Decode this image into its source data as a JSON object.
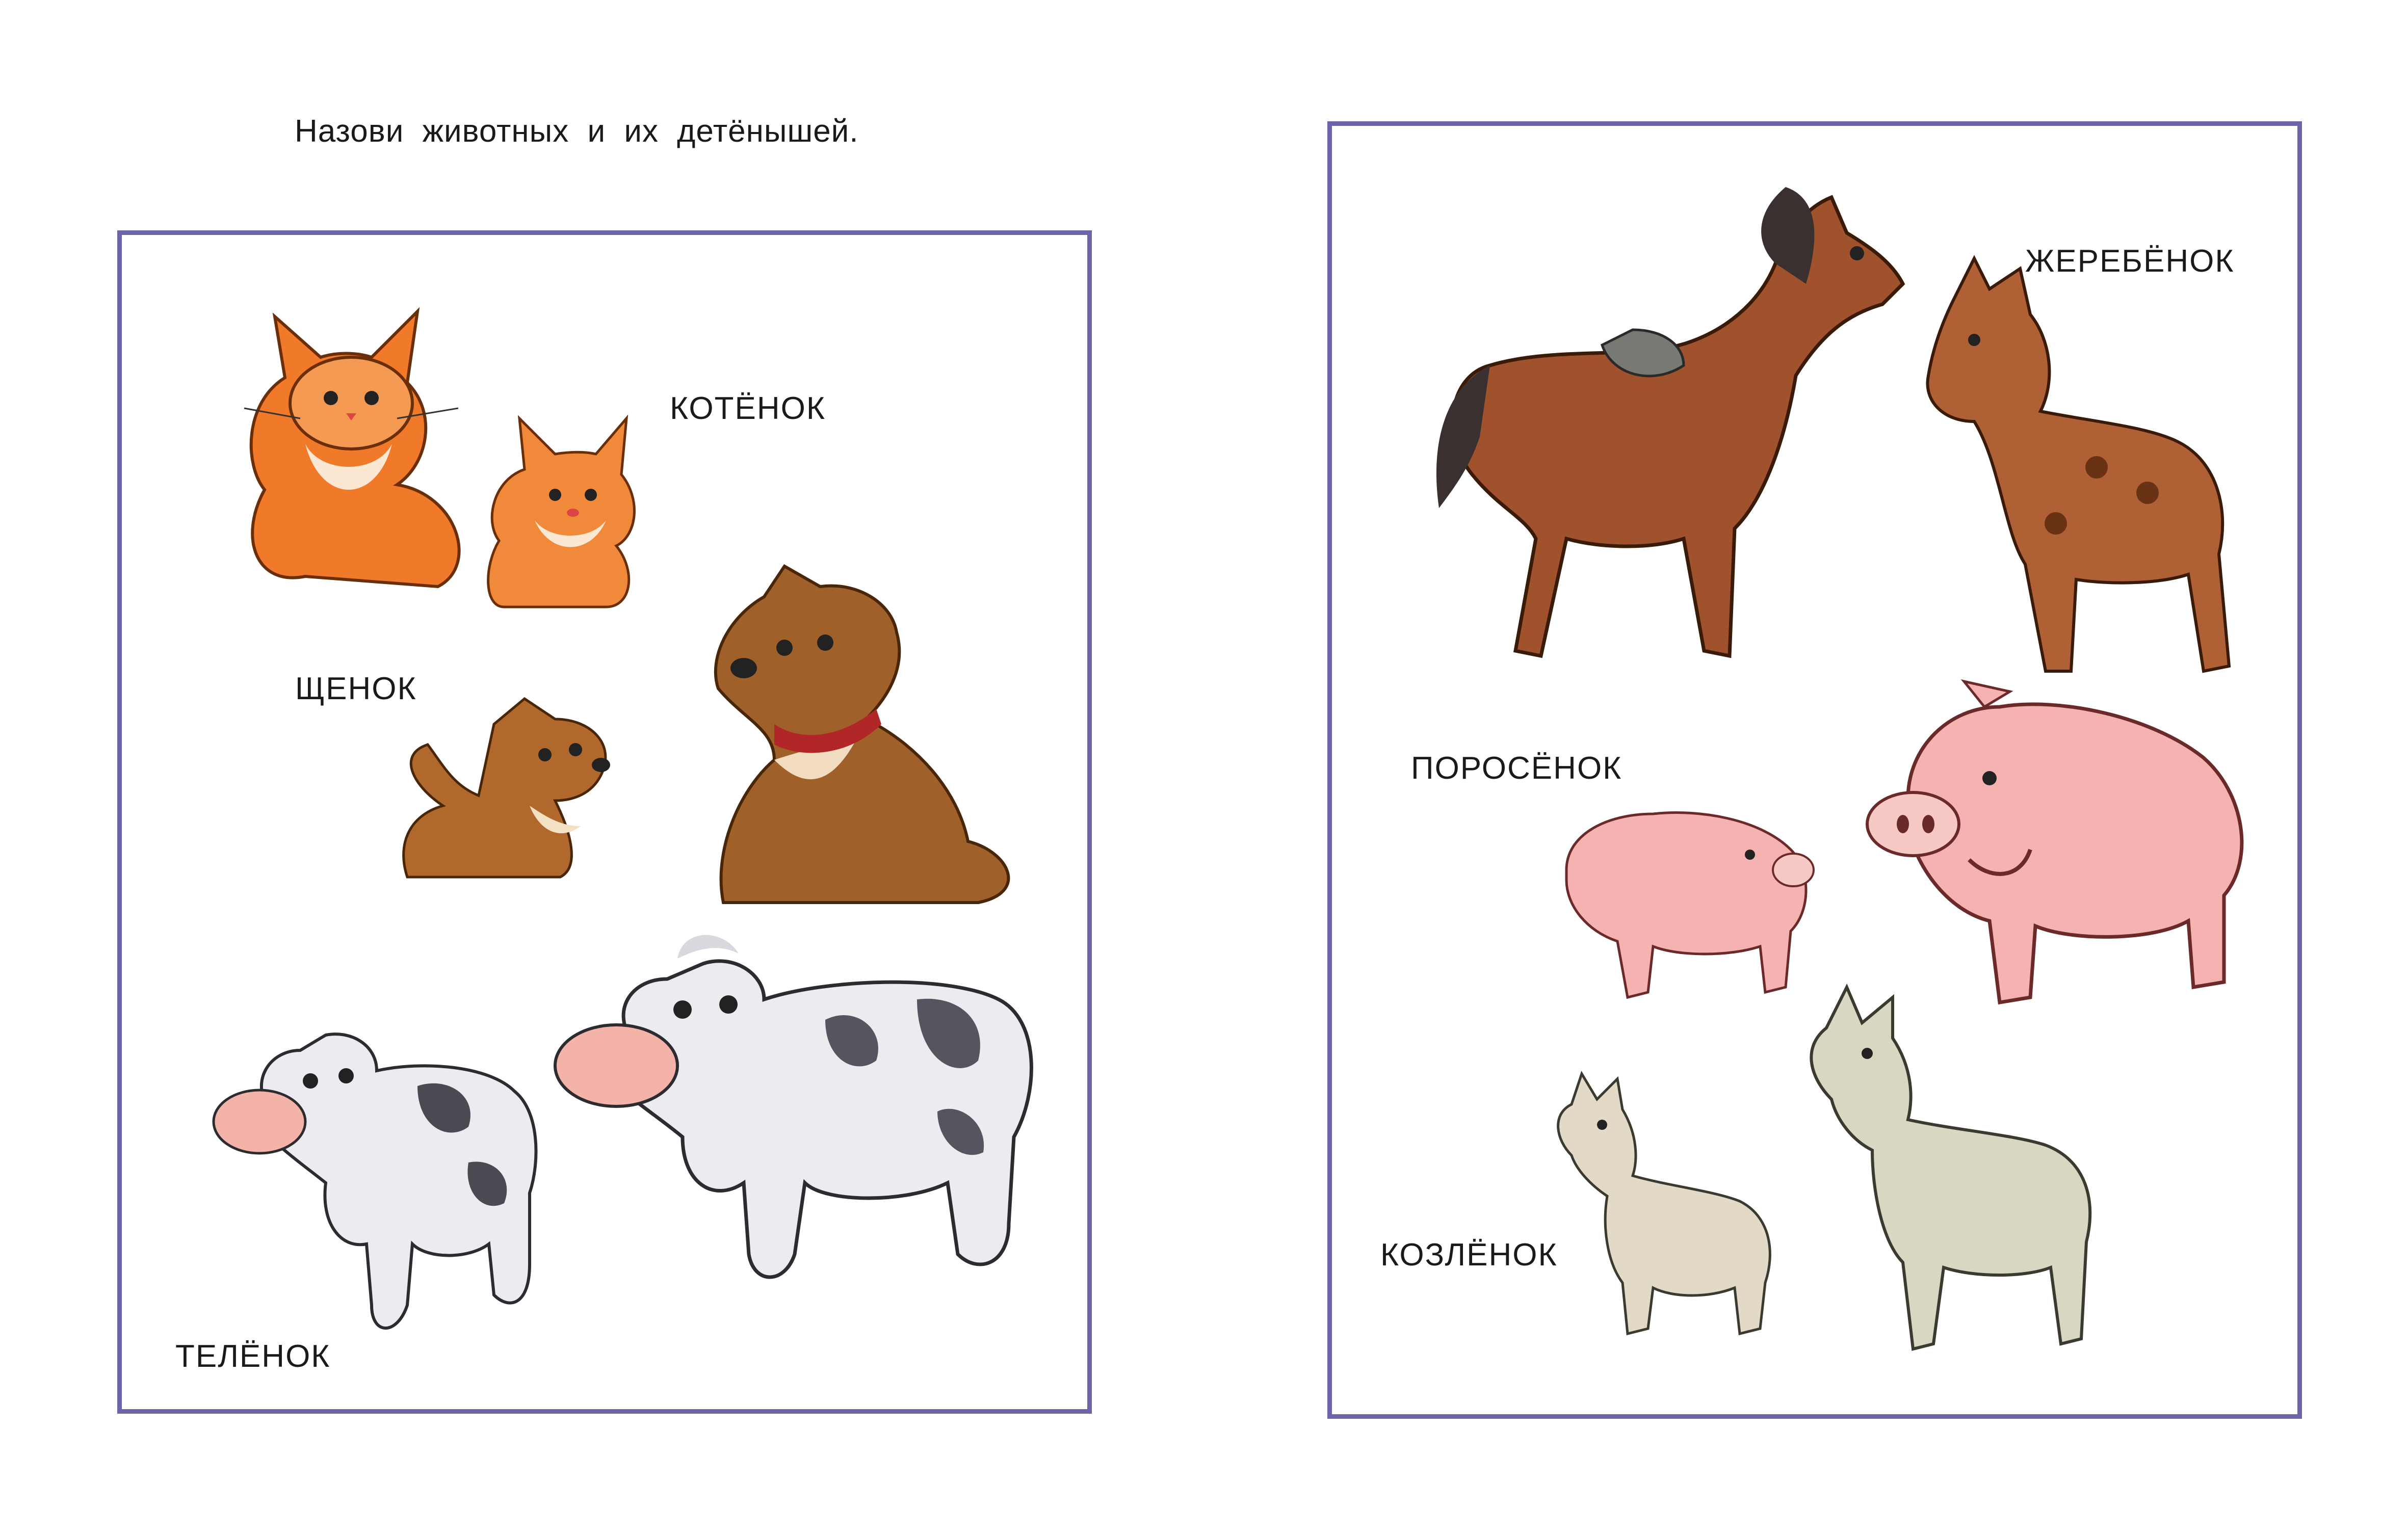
{
  "instruction": "Назови животных и их детёнышей.",
  "left_panel": {
    "labels": {
      "kitten": "КОТЁНОК",
      "puppy": "ЩЕНОК",
      "calf": "ТЕЛЁНОК"
    }
  },
  "right_panel": {
    "labels": {
      "foal": "ЖЕРЕБЁНОК",
      "piglet": "ПОРОСЁНОК",
      "kid": "КОЗЛЁНОК"
    }
  },
  "colors": {
    "frame": "#6b64a6",
    "cat": "#f07a2a",
    "dog": "#a0602a",
    "cow_patch": "#555560",
    "horse": "#a0522d",
    "pig": "#f4b3b0",
    "goat": "#d9d6c2"
  },
  "icons": [
    "cat-illustration",
    "kitten-illustration",
    "dog-illustration",
    "puppy-illustration",
    "cow-illustration",
    "calf-illustration",
    "horse-illustration",
    "foal-illustration",
    "pig-illustration",
    "piglet-illustration",
    "goat-illustration",
    "goat-kid-illustration"
  ]
}
